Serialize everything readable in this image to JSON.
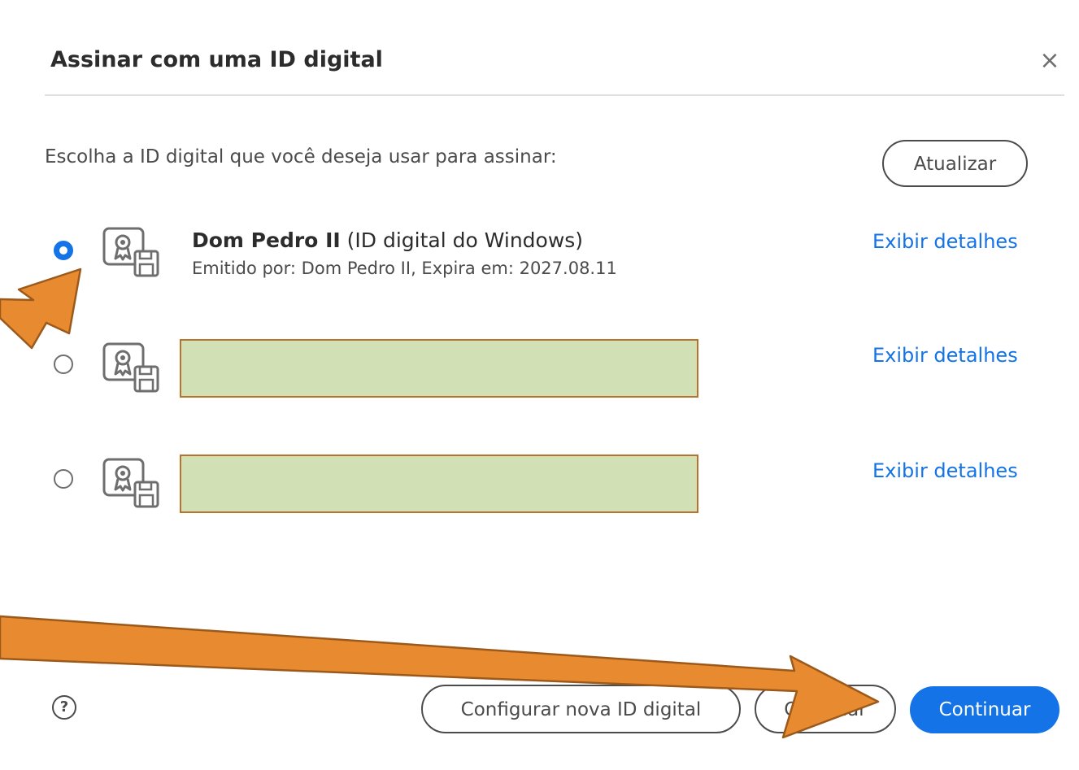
{
  "dialog": {
    "title": "Assinar com uma ID digital",
    "close_icon": "close-icon",
    "prompt": "Escolha a ID digital que você deseja usar para assinar:",
    "refresh_label": "Atualizar"
  },
  "ids": [
    {
      "selected": true,
      "name": "Dom Pedro II",
      "type": "(ID digital do Windows)",
      "issued": "Emitido por: Dom Pedro II, Expira em: 2027.08.11",
      "details_label": "Exibir detalhes",
      "icon": "certificate-icon"
    },
    {
      "selected": false,
      "redacted": true,
      "details_label": "Exibir detalhes",
      "icon": "certificate-icon"
    },
    {
      "selected": false,
      "redacted": true,
      "details_label": "Exibir detalhes",
      "icon": "certificate-icon"
    }
  ],
  "footer": {
    "help_icon": "help-icon",
    "help_glyph": "?",
    "configure_label": "Configurar nova ID digital",
    "cancel_label": "Cancelar",
    "continue_label": "Continuar"
  },
  "colors": {
    "accent": "#1473e6",
    "annotation_arrow": "#e88a30",
    "annotation_arrow_border": "#9b5a1b",
    "redaction_fill": "#d2e0b6",
    "redaction_border": "#b9722d"
  }
}
